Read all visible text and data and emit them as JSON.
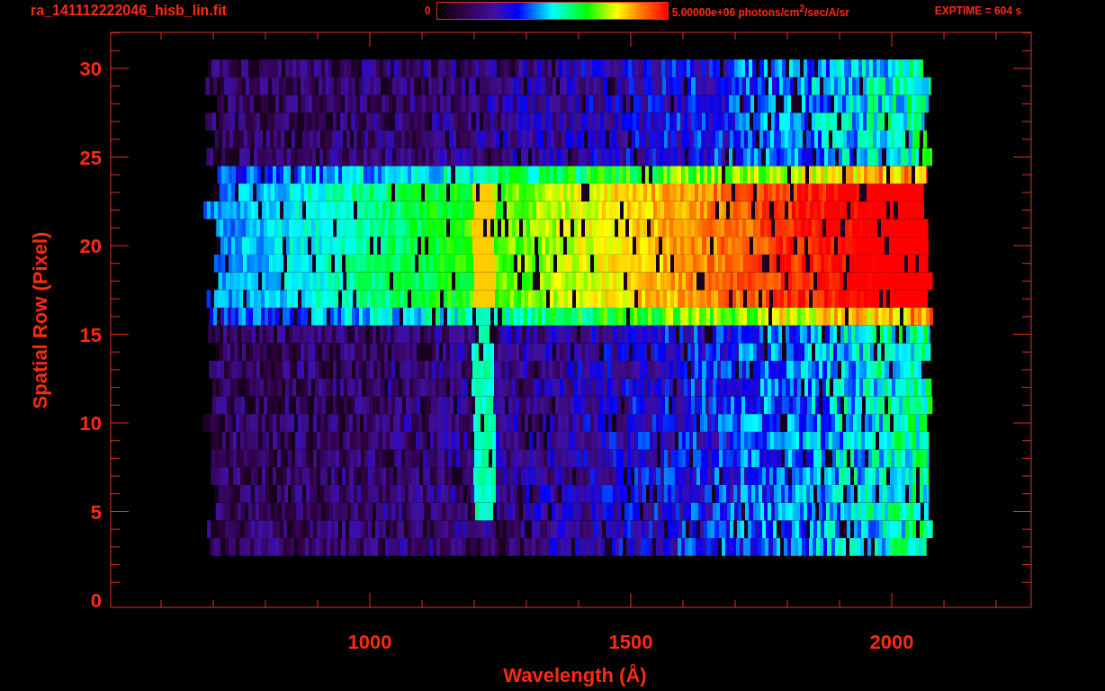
{
  "title": "ra_141112222046_hisb_lin.fit",
  "colorbar": {
    "min_label": "0",
    "max_label": "5.00000e+06 photons/cm$^{2}$/sec/A/sr"
  },
  "exposure": "EXPTIME = 604 s",
  "x_axis": {
    "label": "Wavelength (Å)",
    "ticks": [
      "1000",
      "1500",
      "2000"
    ]
  },
  "y_axis": {
    "label": "Spatial Row (Pixel)",
    "ticks": [
      "30",
      "25",
      "20",
      "15",
      "10",
      "5",
      "0"
    ]
  }
}
